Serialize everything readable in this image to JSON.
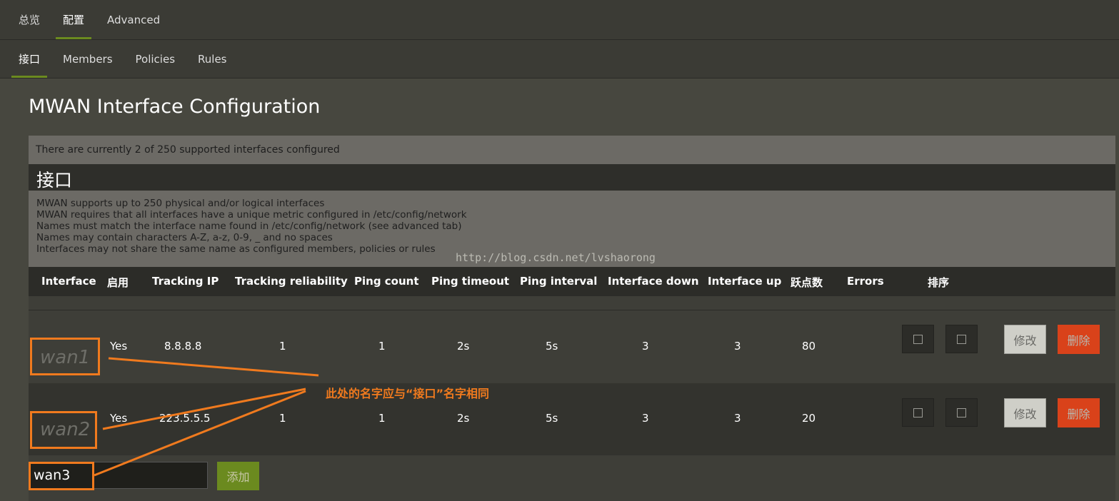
{
  "top_tabs": [
    "总览",
    "配置",
    "Advanced"
  ],
  "sub_tabs": [
    "接口",
    "Members",
    "Policies",
    "Rules"
  ],
  "page_title": "MWAN Interface Configuration",
  "info_text": "There are currently 2 of 250 supported interfaces configured",
  "section_title": "接口",
  "description": [
    "MWAN supports up to 250 physical and/or logical interfaces",
    "MWAN requires that all interfaces have a unique metric configured in /etc/config/network",
    "Names must match the interface name found in /etc/config/network (see advanced tab)",
    "Names may contain characters A-Z, a-z, 0-9, _ and no spaces",
    "Interfaces may not share the same name as configured members, policies or rules"
  ],
  "watermark": "http://blog.csdn.net/lvshaorong",
  "columns": [
    "Interface",
    "启用",
    "Tracking IP",
    "Tracking reliability",
    "Ping count",
    "Ping timeout",
    "Ping interval",
    "Interface down",
    "Interface up",
    "跃点数",
    "Errors",
    "排序"
  ],
  "rows": [
    {
      "name": "wan1",
      "enabled": "Yes",
      "tracking_ip": "8.8.8.8",
      "reliability": "1",
      "ping_count": "1",
      "ping_timeout": "2s",
      "ping_interval": "5s",
      "down": "3",
      "up": "3",
      "metric": "80",
      "errors": "",
      "edit": "修改",
      "delete": "删除"
    },
    {
      "name": "wan2",
      "enabled": "Yes",
      "tracking_ip": "223.5.5.5",
      "reliability": "1",
      "ping_count": "1",
      "ping_timeout": "2s",
      "ping_interval": "5s",
      "down": "3",
      "up": "3",
      "metric": "20",
      "errors": "",
      "edit": "修改",
      "delete": "删除"
    }
  ],
  "add_input_value": "wan3",
  "add_button": "添加",
  "annotation": "此处的名字应与“接口”名字相同",
  "colors": {
    "accent": "#6b8a1f",
    "delete": "#d9421a",
    "annotation": "#f07a1e"
  }
}
